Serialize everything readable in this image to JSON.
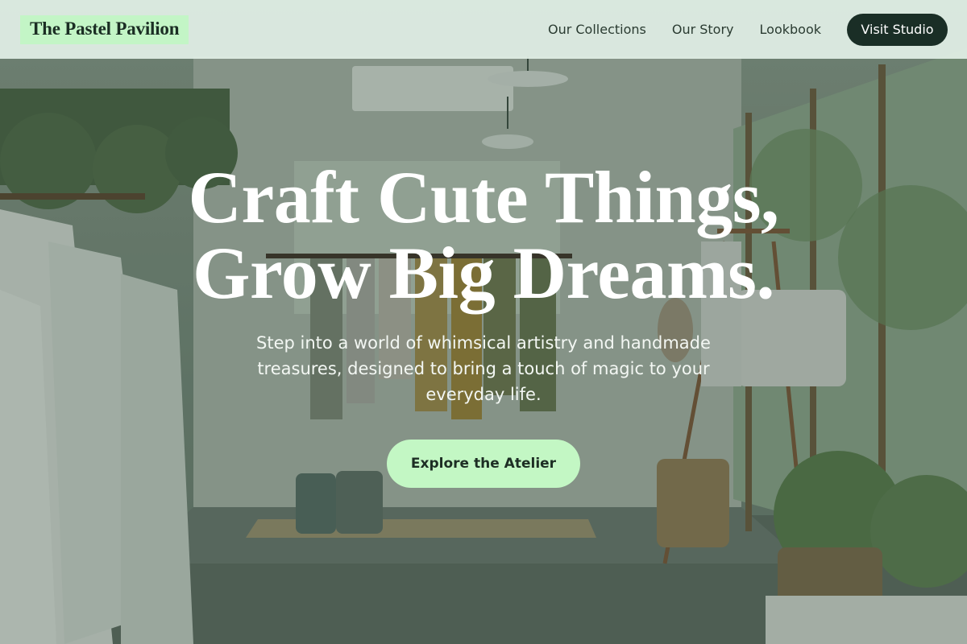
{
  "brand": {
    "name": "The Pastel Pavilion"
  },
  "nav": {
    "links": [
      "Our Collections",
      "Our Story",
      "Lookbook"
    ],
    "cta_label": "Visit Studio"
  },
  "hero": {
    "title_line1": "Craft Cute Things,",
    "title_line2": "Grow Big Dreams.",
    "subtitle": "Step into a world of whimsical artistry and handmade treasures, designed to bring a touch of magic to your everyday life.",
    "cta_label": "Explore the Atelier"
  },
  "colors": {
    "header_bg": "#e0eee4",
    "brand_highlight": "#c3f5c6",
    "dark_button": "#1a2e26",
    "cta_bg": "#c3f7c4",
    "text_light": "#ffffff"
  }
}
